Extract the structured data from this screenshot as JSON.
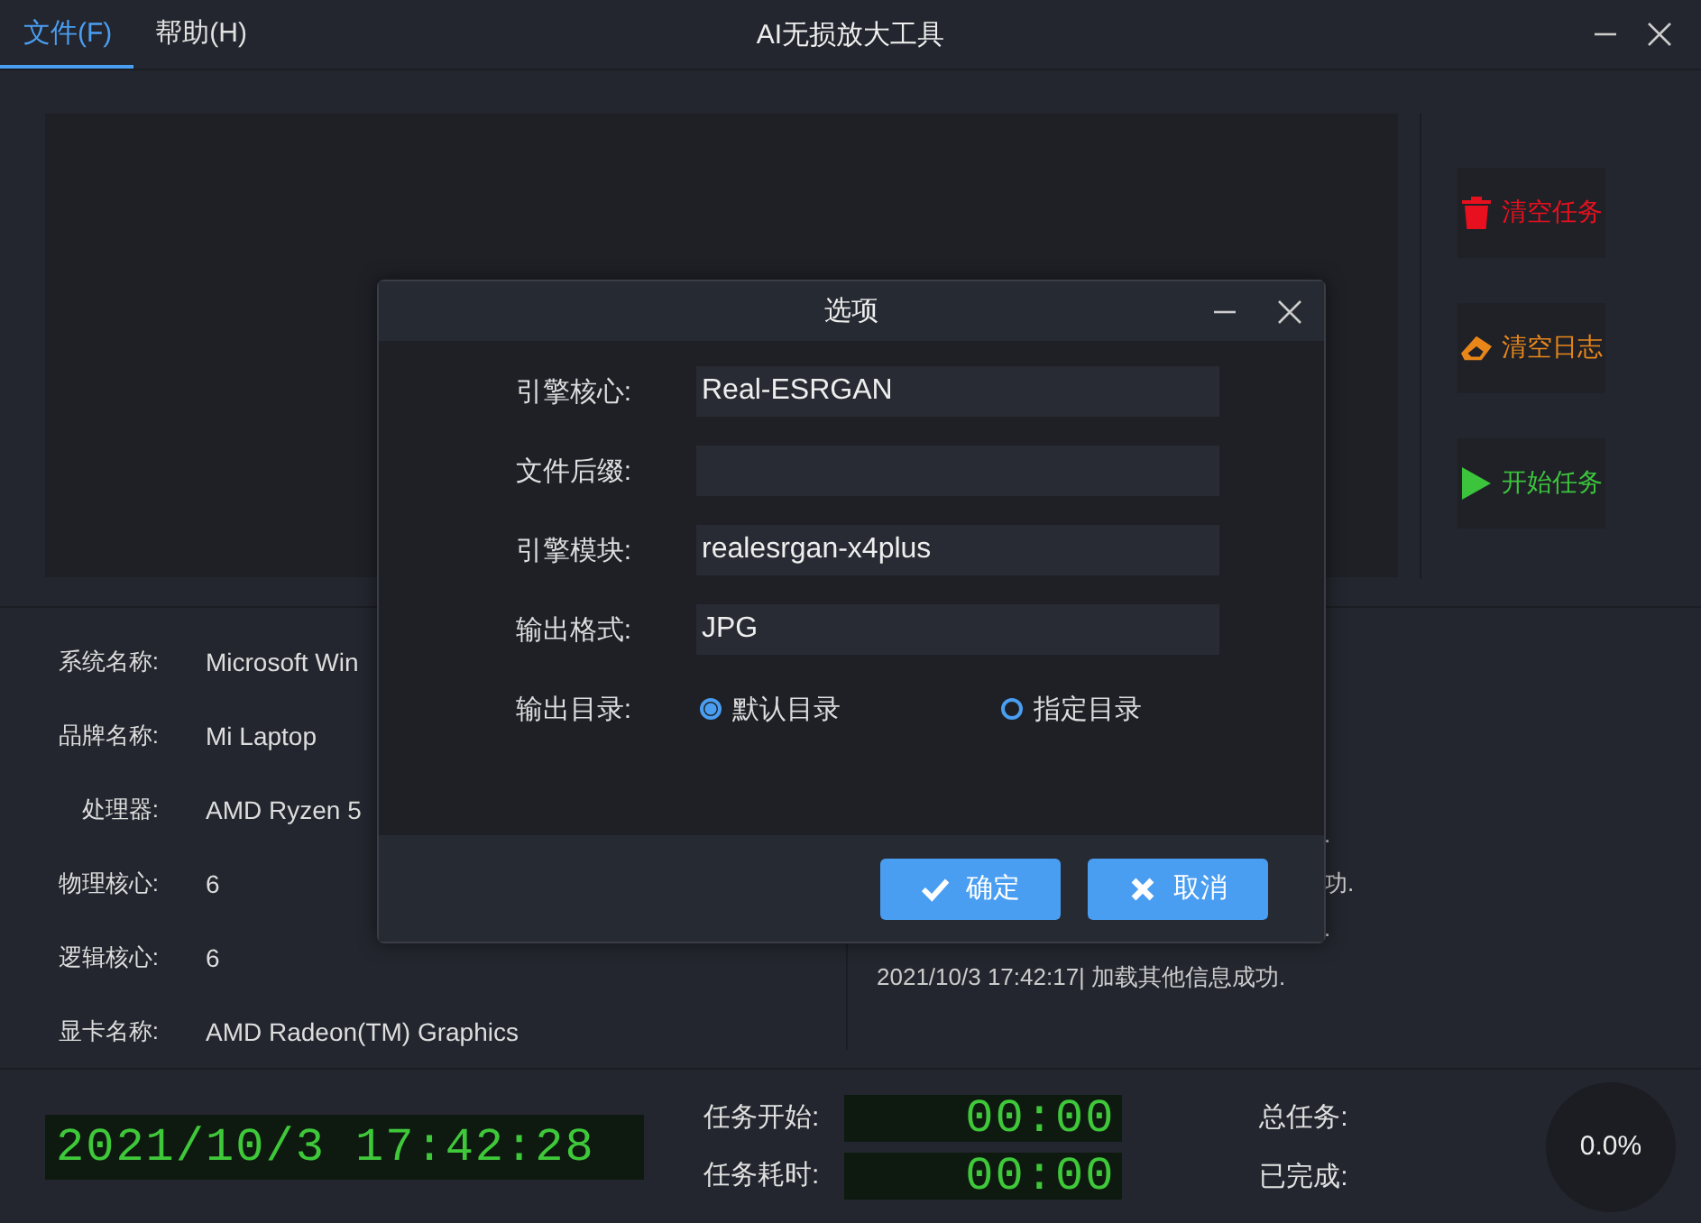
{
  "window": {
    "title": "AI无损放大工具"
  },
  "menu": [
    {
      "label": "文件(F)",
      "selected": true
    },
    {
      "label": "帮助(H)",
      "selected": false
    }
  ],
  "actions": [
    {
      "label": "清空任务",
      "kind": "trash",
      "color": "#e8101e"
    },
    {
      "label": "清空日志",
      "kind": "eraser",
      "color": "#e8861a"
    },
    {
      "label": "开始任务",
      "kind": "play",
      "color": "#3cc43c"
    }
  ],
  "system_info": [
    {
      "label": "系统名称:",
      "value": "Microsoft Win"
    },
    {
      "label": "品牌名称:",
      "value": "Mi Laptop"
    },
    {
      "label": "处理器:",
      "value": "AMD Ryzen 5"
    },
    {
      "label": "物理核心:",
      "value": "6"
    },
    {
      "label": "逻辑核心:",
      "value": "6"
    },
    {
      "label": "显卡名称:",
      "value": "AMD Radeon(TM) Graphics"
    }
  ],
  "log": [
    {
      "text": ".",
      "kind": "partial"
    },
    {
      "text": "功.",
      "kind": "partial"
    },
    {
      "text": ".",
      "kind": "partial"
    },
    {
      "text": "2021/10/3 17:42:17| 加载其他信息成功.",
      "kind": "full"
    }
  ],
  "status": {
    "clock": "2021/10/3 17:42:28",
    "timers": [
      {
        "label": "任务开始:",
        "value": "00:00"
      },
      {
        "label": "任务耗时:",
        "value": "00:00"
      }
    ],
    "counters": [
      {
        "label": "总任务:"
      },
      {
        "label": "已完成:"
      }
    ],
    "progress": "0.0%"
  },
  "dialog": {
    "title": "选项",
    "fields": [
      {
        "label": "引擎核心:",
        "value": "Real-ESRGAN"
      },
      {
        "label": "文件后缀:"
      },
      {
        "label": "引擎模块:",
        "value": "realesrgan-x4plus"
      },
      {
        "label": "输出格式:",
        "value": "JPG"
      }
    ],
    "output_dir": {
      "label": "输出目录:",
      "options": [
        {
          "label": "默认目录",
          "selected": true
        },
        {
          "label": "指定目录",
          "selected": false
        }
      ]
    },
    "buttons": [
      {
        "label": "确定",
        "kind": "ok"
      },
      {
        "label": "取消",
        "kind": "cancel"
      }
    ]
  }
}
